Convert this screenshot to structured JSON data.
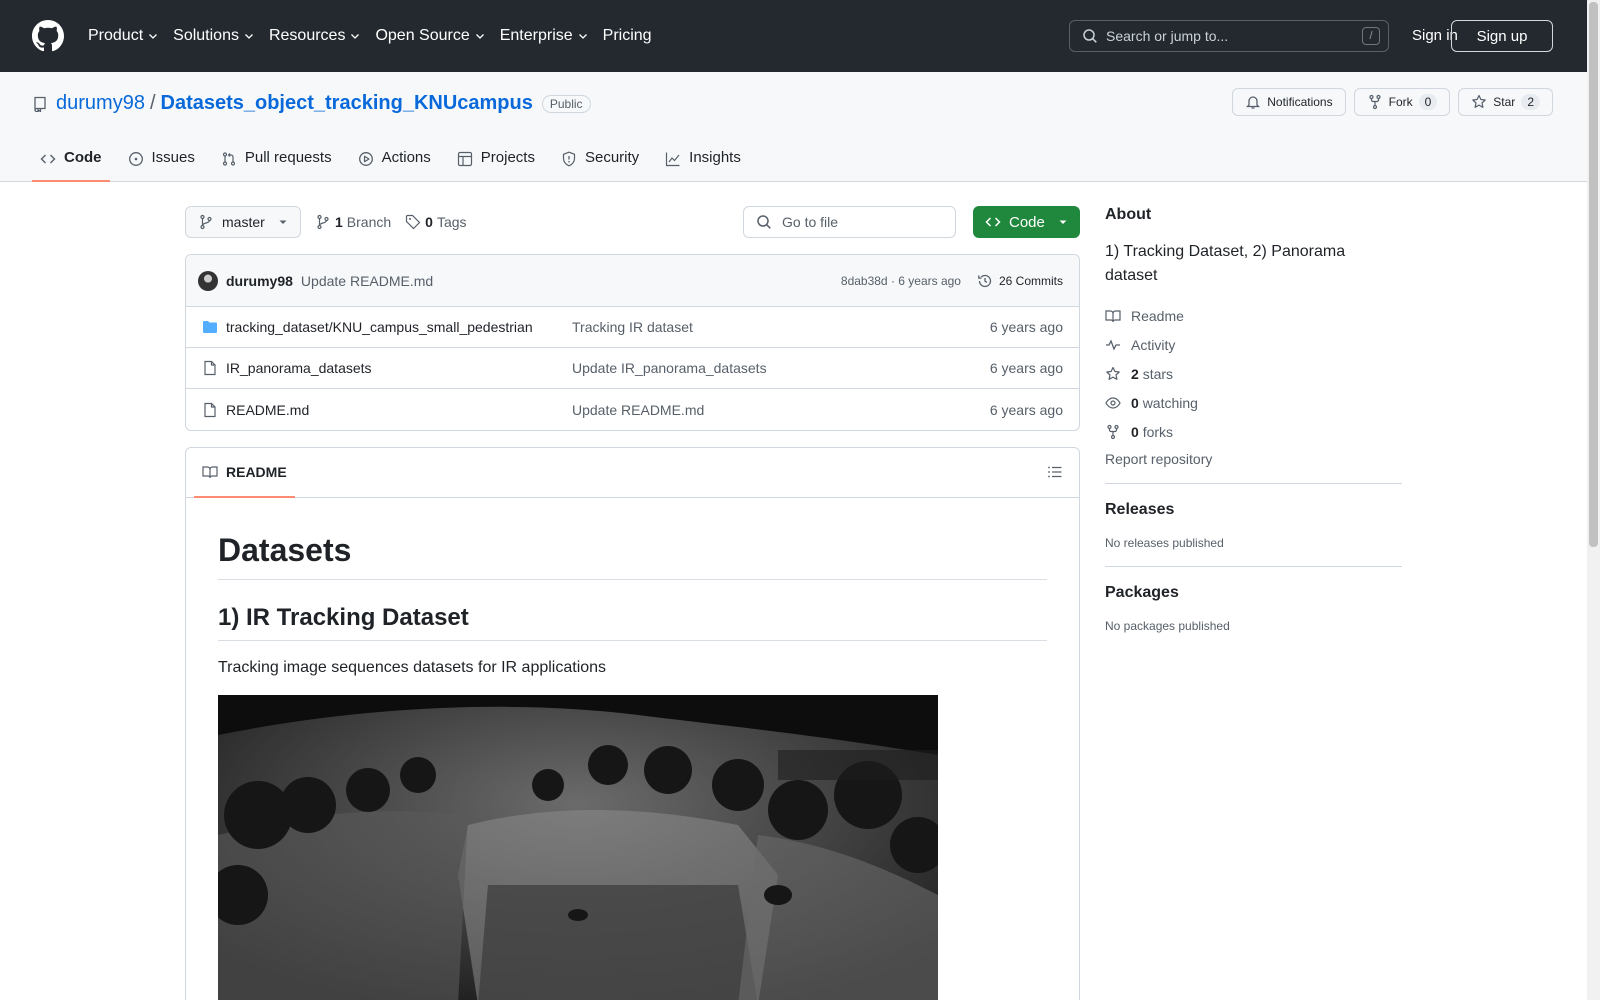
{
  "header": {
    "nav": [
      {
        "label": "Product",
        "has_menu": true
      },
      {
        "label": "Solutions",
        "has_menu": true
      },
      {
        "label": "Resources",
        "has_menu": true
      },
      {
        "label": "Open Source",
        "has_menu": true
      },
      {
        "label": "Enterprise",
        "has_menu": true
      },
      {
        "label": "Pricing",
        "has_menu": false
      }
    ],
    "search_placeholder": "Search or jump to...",
    "search_shortcut": "/",
    "sign_in": "Sign in",
    "sign_up": "Sign up"
  },
  "repo": {
    "owner": "durumy98",
    "separator": "/",
    "name": "Datasets_object_tracking_KNUcampus",
    "visibility": "Public",
    "notifications_label": "Notifications",
    "fork_label": "Fork",
    "fork_count": "0",
    "star_label": "Star",
    "star_count": "2"
  },
  "tabs": [
    {
      "label": "Code",
      "icon": "code-icon",
      "active": true
    },
    {
      "label": "Issues",
      "icon": "issue-icon",
      "active": false
    },
    {
      "label": "Pull requests",
      "icon": "pull-request-icon",
      "active": false
    },
    {
      "label": "Actions",
      "icon": "play-icon",
      "active": false
    },
    {
      "label": "Projects",
      "icon": "table-icon",
      "active": false
    },
    {
      "label": "Security",
      "icon": "shield-icon",
      "active": false
    },
    {
      "label": "Insights",
      "icon": "graph-icon",
      "active": false
    }
  ],
  "toolbar": {
    "branch": "master",
    "branch_count": "1",
    "branch_label": "Branch",
    "tag_count": "0",
    "tag_label": "Tags",
    "goto_placeholder": "Go to file",
    "code_button": "Code"
  },
  "commit": {
    "author": "durumy98",
    "message": "Update README.md",
    "hash_age": "8dab38d · 6 years ago",
    "commits_label": "26 Commits"
  },
  "files": [
    {
      "type": "folder",
      "name": "tracking_dataset/KNU_campus_small_pedestrian",
      "message": "Tracking IR dataset",
      "age": "6 years ago"
    },
    {
      "type": "file",
      "name": "IR_panorama_datasets",
      "message": "Update IR_panorama_datasets",
      "age": "6 years ago"
    },
    {
      "type": "file",
      "name": "README.md",
      "message": "Update README.md",
      "age": "6 years ago"
    }
  ],
  "readme": {
    "tab_label": "README",
    "h1": "Datasets",
    "h2": "1) IR Tracking Dataset",
    "paragraph": "Tracking image sequences datasets for IR applications"
  },
  "about": {
    "title": "About",
    "description": "1) Tracking Dataset, 2) Panorama dataset",
    "readme": "Readme",
    "activity": "Activity",
    "stars_count": "2",
    "stars_label": "stars",
    "watching_count": "0",
    "watching_label": "watching",
    "forks_count": "0",
    "forks_label": "forks",
    "report": "Report repository"
  },
  "releases": {
    "title": "Releases",
    "empty": "No releases published"
  },
  "packages": {
    "title": "Packages",
    "empty": "No packages published"
  },
  "colors": {
    "header_bg": "#24292f",
    "link": "#0969da",
    "primary_button": "#1f883d",
    "active_tab_underline": "#fd8c73",
    "folder_icon": "#54aeff"
  }
}
